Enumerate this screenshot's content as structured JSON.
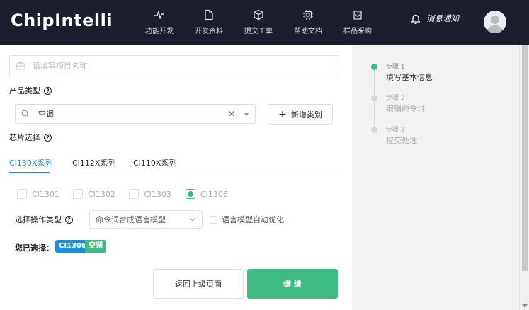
{
  "header": {
    "logo": "ChipIntelli",
    "nav": [
      {
        "label": "功能开发",
        "icon": "pulse-icon"
      },
      {
        "label": "开发资料",
        "icon": "document-icon"
      },
      {
        "label": "提交工单",
        "icon": "cube-icon"
      },
      {
        "label": "帮助文档",
        "icon": "chip-icon"
      },
      {
        "label": "样品采购",
        "icon": "shopping-bag-icon"
      }
    ],
    "notification": "消息通知"
  },
  "form": {
    "project_placeholder": "请填写项目名称",
    "product_type_label": "产品类型",
    "product_type_value": "空调",
    "add_category": "新增类别",
    "chip_select_label": "芯片选择",
    "tabs": [
      "CI130X系列",
      "CI112X系列",
      "CI110X系列"
    ],
    "chips": [
      "CI1301",
      "CI1302",
      "CI1303",
      "CI1306"
    ],
    "selected_chip_index": 3,
    "op_type_label": "选择操作类型",
    "op_type_value": "命令词合成语言模型",
    "auto_optimize": "语言模型自动优化",
    "selected_label": "您已选择：",
    "selected_tags": [
      "CI1306",
      "空调"
    ],
    "back_button": "返回上级页面",
    "next_button": "继 续"
  },
  "steps": [
    {
      "num": "步骤 1",
      "title": "填写基本信息",
      "active": true
    },
    {
      "num": "步骤 2",
      "title": "编辑命令词",
      "active": false
    },
    {
      "num": "步骤 3",
      "title": "提交处理",
      "active": false
    }
  ],
  "colors": {
    "header_bg": "#1b1f2d",
    "accent_blue": "#1f8fdb",
    "accent_green": "#3dbb83"
  }
}
